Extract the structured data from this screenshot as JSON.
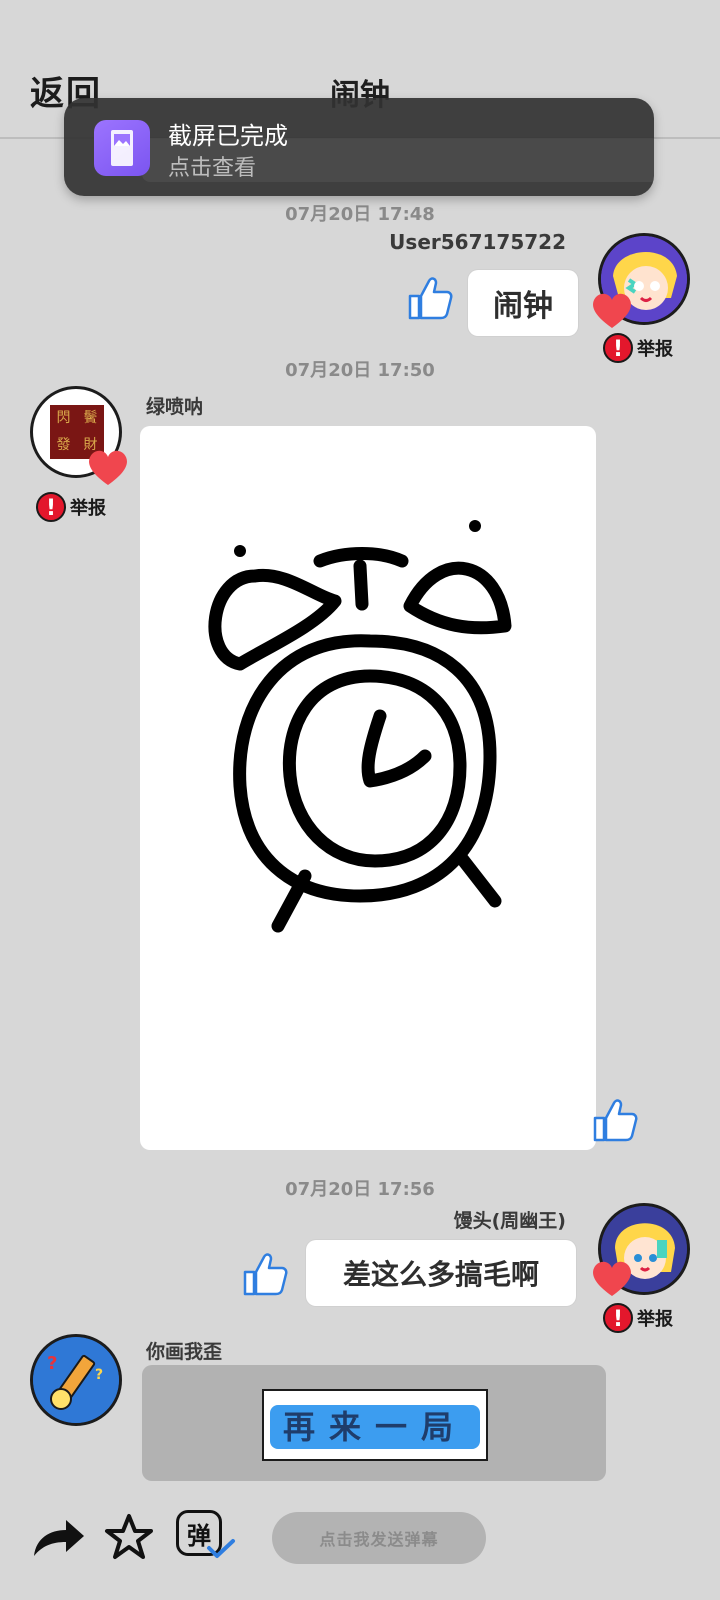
{
  "header": {
    "back_label": "返回",
    "title": "闹钟"
  },
  "toast": {
    "title": "截屏已完成",
    "subtitle": "点击查看"
  },
  "messages": [
    {
      "timestamp": "07月20日  17:48",
      "user": "User567175722",
      "text": "闹钟",
      "report_label": "举报"
    },
    {
      "timestamp": "07月20日  17:50",
      "user": "绿喷呐",
      "report_label": "举报",
      "avatar_text": [
        "閃",
        "發",
        "鬢",
        "財"
      ]
    },
    {
      "timestamp": "07月20日  17:56",
      "user": "馒头(周幽王)",
      "text": "差这么多搞毛啊",
      "report_label": "举报"
    },
    {
      "user": "你画我歪",
      "button_label": "再来一局"
    }
  ],
  "bottom_bar": {
    "danmaku_placeholder": "点击我发送弹幕",
    "danmaku_icon_text": "弹"
  },
  "colors": {
    "background": "#d7d7d7",
    "accent_blue": "#3c9df0",
    "report_red": "#e3172c",
    "heart": "#f0464e"
  }
}
